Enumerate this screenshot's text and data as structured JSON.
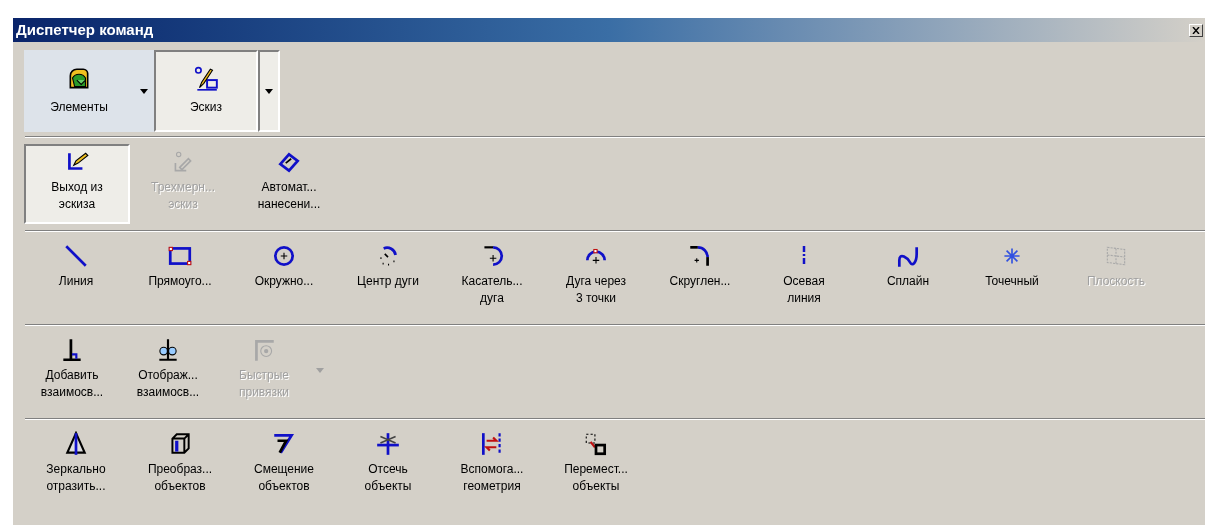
{
  "window": {
    "title": "Диспетчер команд"
  },
  "tabs": [
    {
      "label": "Элементы",
      "selected": false
    },
    {
      "label": "Эскиз",
      "selected": true
    }
  ],
  "toolbars": [
    {
      "buttons": [
        {
          "label": "Выход из\nэскиза",
          "selected": true,
          "disabled": false,
          "dropdown": false
        },
        {
          "label": "Трехмерн...\nэскиз",
          "selected": false,
          "disabled": true,
          "dropdown": false
        },
        {
          "label": "Автомат...\nнанесени...",
          "selected": false,
          "disabled": false,
          "dropdown": false
        }
      ]
    },
    {
      "buttons": [
        {
          "label": "Линия",
          "selected": false,
          "disabled": false,
          "dropdown": false
        },
        {
          "label": "Прямоуго...",
          "selected": false,
          "disabled": false,
          "dropdown": false
        },
        {
          "label": "Окружно...",
          "selected": false,
          "disabled": false,
          "dropdown": false
        },
        {
          "label": "Центр дуги",
          "selected": false,
          "disabled": false,
          "dropdown": false
        },
        {
          "label": "Касатель...\nдуга",
          "selected": false,
          "disabled": false,
          "dropdown": false
        },
        {
          "label": "Дуга через\n3 точки",
          "selected": false,
          "disabled": false,
          "dropdown": false
        },
        {
          "label": "Скруглен...",
          "selected": false,
          "disabled": false,
          "dropdown": false
        },
        {
          "label": "Осевая\nлиния",
          "selected": false,
          "disabled": false,
          "dropdown": false
        },
        {
          "label": "Сплайн",
          "selected": false,
          "disabled": false,
          "dropdown": false
        },
        {
          "label": "Точечный",
          "selected": false,
          "disabled": false,
          "dropdown": false
        },
        {
          "label": "Плоскость",
          "selected": false,
          "disabled": true,
          "dropdown": false
        }
      ]
    },
    {
      "buttons": [
        {
          "label": "Добавить\nвзаимосв...",
          "selected": false,
          "disabled": false,
          "dropdown": false
        },
        {
          "label": "Отображ...\nвзаимосв...",
          "selected": false,
          "disabled": false,
          "dropdown": false
        },
        {
          "label": "Быстрые\nпривязки",
          "selected": false,
          "disabled": true,
          "dropdown": true
        }
      ]
    },
    {
      "buttons": [
        {
          "label": "Зеркально\nотразить...",
          "selected": false,
          "disabled": false,
          "dropdown": false
        },
        {
          "label": "Преобраз...\nобъектов",
          "selected": false,
          "disabled": false,
          "dropdown": false
        },
        {
          "label": "Смещение\nобъектов",
          "selected": false,
          "disabled": false,
          "dropdown": false
        },
        {
          "label": "Отсечь\nобъекты",
          "selected": false,
          "disabled": false,
          "dropdown": false
        },
        {
          "label": "Вспомога...\nгеометрия",
          "selected": false,
          "disabled": false,
          "dropdown": false
        },
        {
          "label": "Перемест...\nобъекты",
          "selected": false,
          "disabled": false,
          "dropdown": false
        }
      ]
    }
  ]
}
